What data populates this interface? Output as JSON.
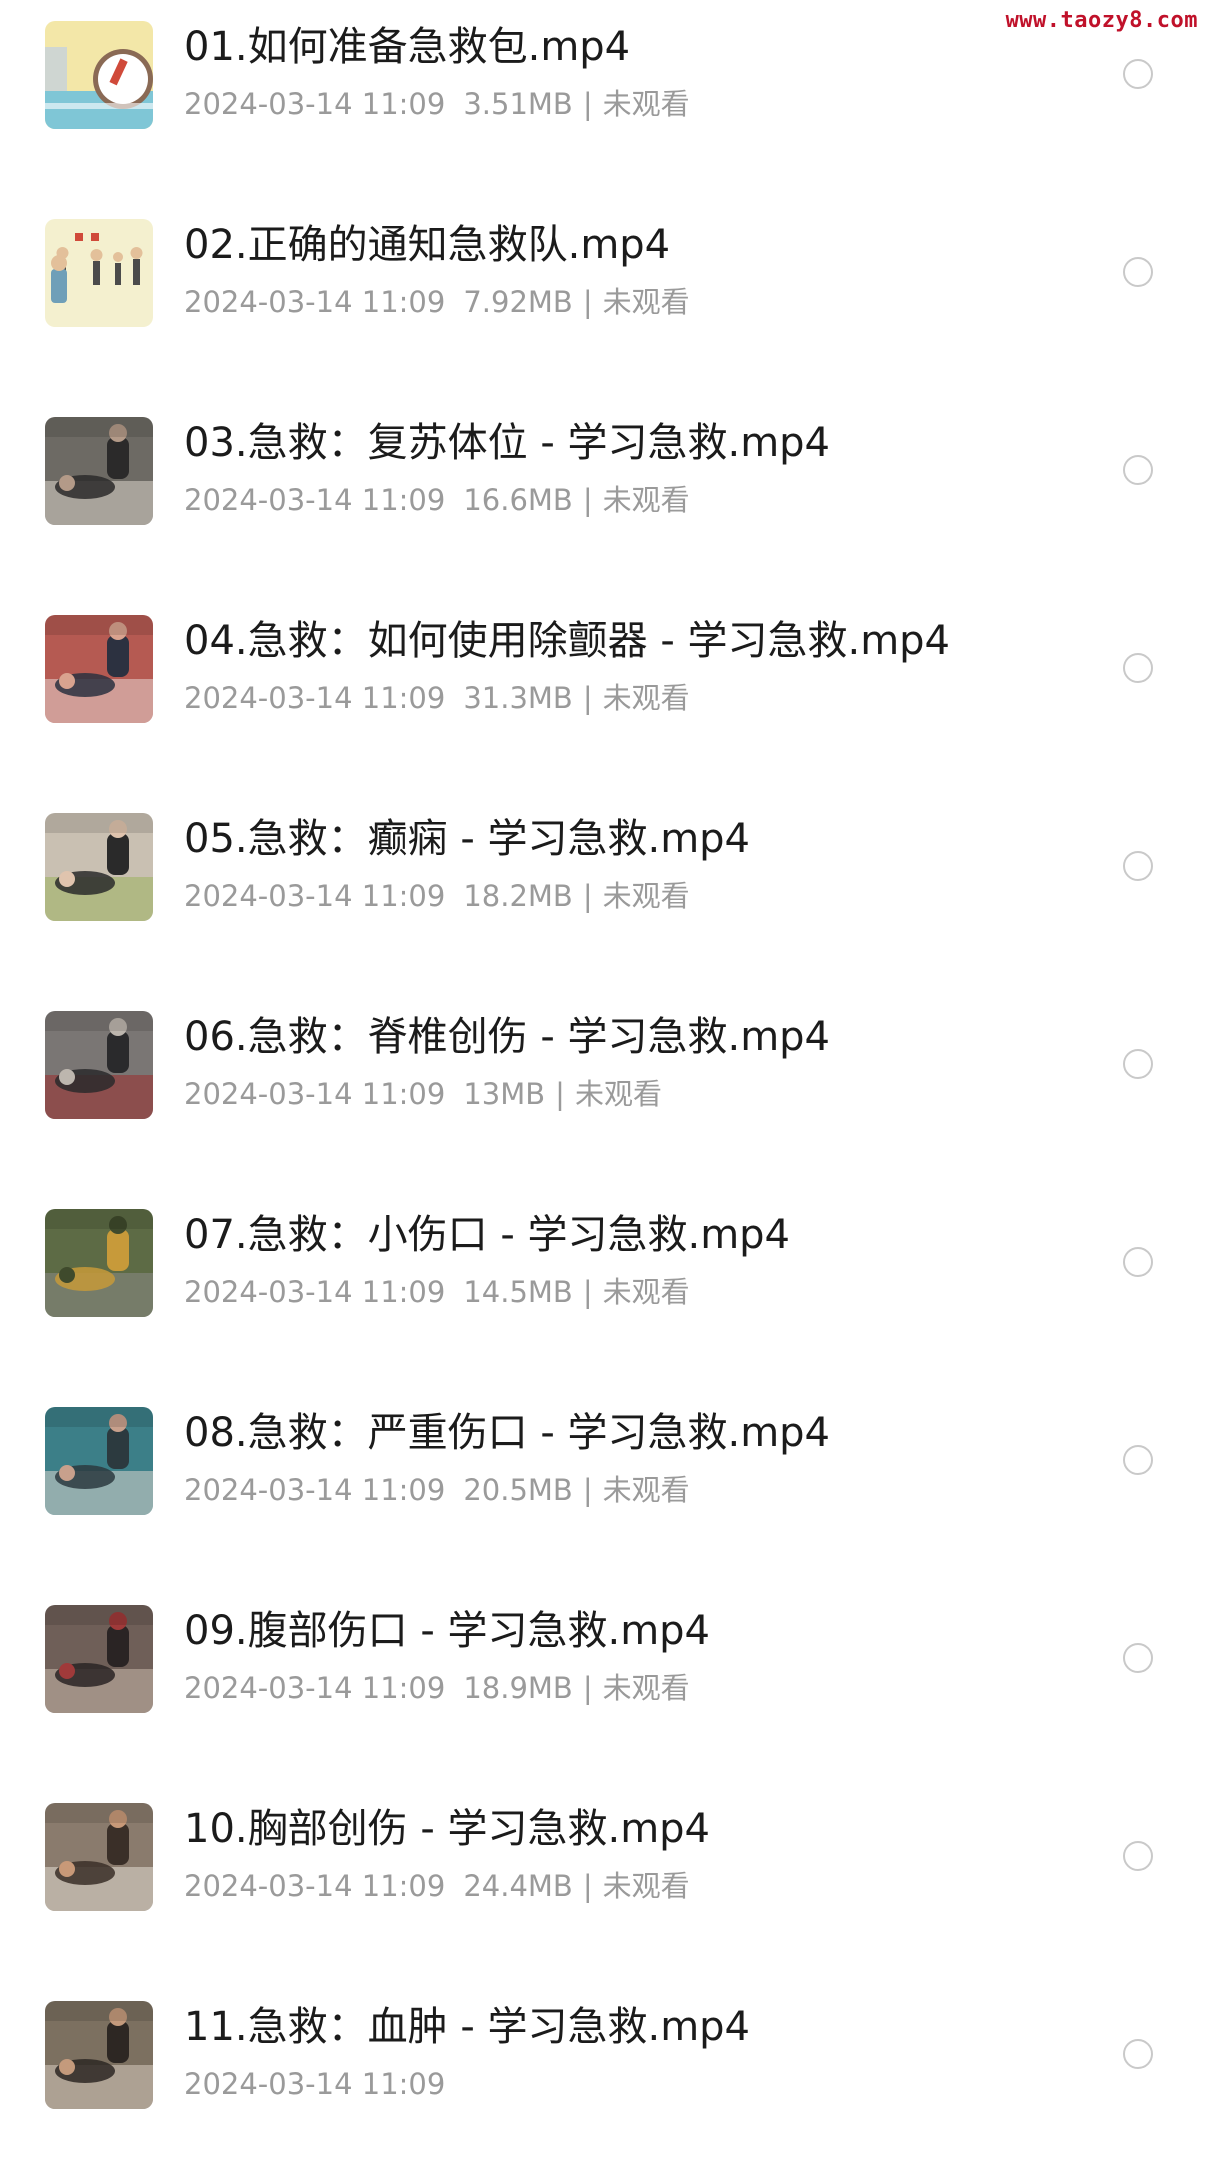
{
  "watermark": "www.taozy8.com",
  "files": [
    {
      "title": "01.如何准备急救包.mp4",
      "date": "2024-03-14 11:09",
      "size": "3.51MB",
      "status": "未观看",
      "thumb": {
        "bg": "#f3e7a8",
        "a": "#7fc6d6",
        "b": "#8a6a55",
        "c": "#ffffff",
        "kind": "cartoon-kit"
      }
    },
    {
      "title": "02.正确的通知急救队.mp4",
      "date": "2024-03-14 11:09",
      "size": "7.92MB",
      "status": "未观看",
      "thumb": {
        "bg": "#f4f0cf",
        "a": "#6f9fb8",
        "b": "#4b4b4b",
        "c": "#e3c09a",
        "kind": "cartoon-people"
      }
    },
    {
      "title": "03.急救：复苏体位 - 学习急救.mp4",
      "date": "2024-03-14 11:09",
      "size": "16.6MB",
      "status": "未观看",
      "thumb": {
        "bg": "#6d6a64",
        "a": "#d8d2c8",
        "b": "#2b2a2a",
        "c": "#b39a88",
        "kind": "photo"
      }
    },
    {
      "title": "04.急救：如何使用除颤器 - 学习急救.mp4",
      "date": "2024-03-14 11:09",
      "size": "31.3MB",
      "status": "未观看",
      "thumb": {
        "bg": "#b55a52",
        "a": "#e6d6cf",
        "b": "#2c3140",
        "c": "#d9a38f",
        "kind": "photo"
      }
    },
    {
      "title": "05.急救：癫痫 - 学习急救.mp4",
      "date": "2024-03-14 11:09",
      "size": "18.2MB",
      "status": "未观看",
      "thumb": {
        "bg": "#c9c0b2",
        "a": "#9bb05e",
        "b": "#2a2a2a",
        "c": "#e0c4ae",
        "kind": "photo"
      }
    },
    {
      "title": "06.急救：脊椎创伤 - 学习急救.mp4",
      "date": "2024-03-14 11:09",
      "size": "13MB",
      "status": "未观看",
      "thumb": {
        "bg": "#7a7674",
        "a": "#9a2d2d",
        "b": "#2a2a2c",
        "c": "#bdb6ae",
        "kind": "photo"
      }
    },
    {
      "title": "07.急救：小伤口 - 学习急救.mp4",
      "date": "2024-03-14 11:09",
      "size": "14.5MB",
      "status": "未观看",
      "thumb": {
        "bg": "#5d6b45",
        "a": "#8a8a86",
        "b": "#c79a3a",
        "c": "#3f4a2c",
        "kind": "photo"
      }
    },
    {
      "title": "08.急救：严重伤口 - 学习急救.mp4",
      "date": "2024-03-14 11:09",
      "size": "20.5MB",
      "status": "未观看",
      "thumb": {
        "bg": "#3c7f88",
        "a": "#d9d4cc",
        "b": "#2c3a3f",
        "c": "#c8a08c",
        "kind": "photo"
      }
    },
    {
      "title": "09.腹部伤口 - 学习急救.mp4",
      "date": "2024-03-14 11:09",
      "size": "18.9MB",
      "status": "未观看",
      "thumb": {
        "bg": "#6f5f58",
        "a": "#c9b8ac",
        "b": "#2a2424",
        "c": "#a03a3a",
        "kind": "photo"
      }
    },
    {
      "title": "10.胸部创伤 - 学习急救.mp4",
      "date": "2024-03-14 11:09",
      "size": "24.4MB",
      "status": "未观看",
      "thumb": {
        "bg": "#8a7b6d",
        "a": "#e2dcd2",
        "b": "#3a2f28",
        "c": "#c89978",
        "kind": "photo"
      }
    },
    {
      "title": "11.急救：血肿 - 学习急救.mp4",
      "date": "2024-03-14 11:09",
      "size": "",
      "status": "",
      "thumb": {
        "bg": "#7c7060",
        "a": "#d6cbbd",
        "b": "#2d2723",
        "c": "#c49a7c",
        "kind": "photo"
      }
    }
  ]
}
